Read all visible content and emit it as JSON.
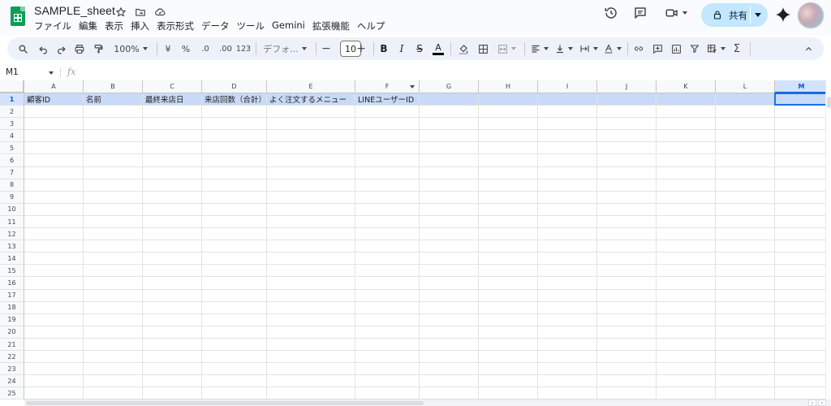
{
  "app": {
    "title": "SAMPLE_sheet",
    "menu": [
      "ファイル",
      "編集",
      "表示",
      "挿入",
      "表示形式",
      "データ",
      "ツール",
      "Gemini",
      "拡張機能",
      "ヘルプ"
    ],
    "share_label": "共有",
    "accent_color": "#0b57d0",
    "logo_color": "#0f9d58"
  },
  "toolbar": {
    "zoom": "100%",
    "currency": "¥",
    "percent": "%",
    "decimal_decrease": ".0",
    "decimal_increase": ".00",
    "number_format": "123",
    "font_family": "デフォ...",
    "font_size": "10",
    "font_minus": "−",
    "font_plus": "+",
    "bold": "B",
    "italic": "I",
    "strikethrough": "S",
    "text_color": "A",
    "sum": "Σ"
  },
  "formula_bar": {
    "cell_ref": "M1",
    "fx": "fx",
    "value": ""
  },
  "sheet": {
    "columns": [
      "A",
      "B",
      "C",
      "D",
      "E",
      "F",
      "G",
      "H",
      "I",
      "J",
      "K",
      "L",
      "M"
    ],
    "active_column": "M",
    "active_row": 1,
    "filter_column": "F",
    "rows": [
      "1",
      "2",
      "3",
      "4",
      "5",
      "6",
      "7",
      "8",
      "9",
      "10",
      "11",
      "12",
      "13",
      "14",
      "15",
      "16",
      "17",
      "18",
      "19",
      "20",
      "21",
      "22",
      "23",
      "24",
      "25"
    ],
    "header_values": [
      "顧客ID",
      "名前",
      "最終来店日",
      "来店回数（合計）",
      "よく注文するメニュー",
      "LINEユーザーID",
      "",
      "",
      "",
      "",
      "",
      "",
      ""
    ],
    "header_fill": "#c9daf8"
  }
}
